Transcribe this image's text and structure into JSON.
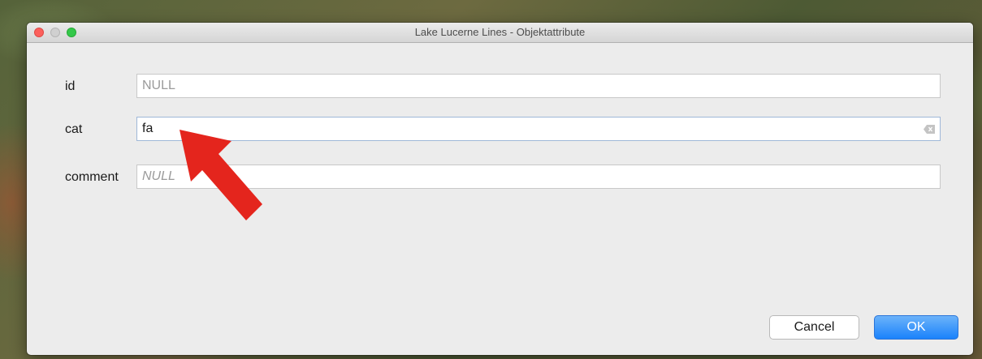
{
  "window": {
    "title": "Lake Lucerne Lines - Objektattribute"
  },
  "fields": [
    {
      "label": "id",
      "value": "",
      "placeholder": "NULL",
      "style": "normal"
    },
    {
      "label": "cat",
      "value": "fa",
      "placeholder": "",
      "style": "normal"
    },
    {
      "label": "comment",
      "value": "",
      "placeholder": "NULL",
      "style": "italic"
    }
  ],
  "buttons": {
    "cancel": "Cancel",
    "ok": "OK"
  },
  "icons": {
    "close": "close-window-icon",
    "minimize": "minimize-window-icon",
    "zoom": "zoom-window-icon",
    "clear": "clear-field-icon",
    "annotation": "red-arrow-icon"
  },
  "colors": {
    "arrow": "#e4251d",
    "ok_button": "#1a82fb",
    "close_light": "#fc605c",
    "zoom_light": "#34c84a"
  }
}
